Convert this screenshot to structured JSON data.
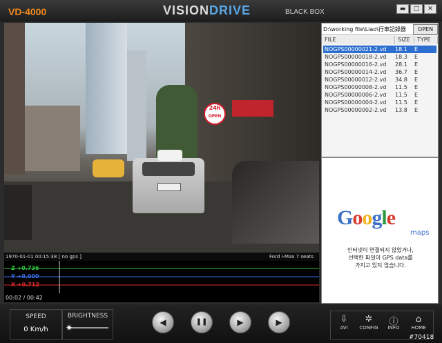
{
  "window": {
    "brand": "VD-4000",
    "title_main": "VISION",
    "title_accent": "DRIVE",
    "subtitle": "BLACK BOX",
    "minimize": "▬",
    "maximize": "□",
    "close": "✕"
  },
  "video": {
    "timestamp": "1970-01-01 00:15:38 [ no gps ]",
    "vehicle": "Ford i-Max 7 seats",
    "sign_text": "24h",
    "sign_sub": "OPEN"
  },
  "graph": {
    "z_label": "Z +0.736",
    "y_label": "Y +0.000",
    "x_label": "X +0.712",
    "colors": {
      "z": "#2ec23a",
      "y": "#3a6ee8",
      "x": "#e02b2b"
    },
    "time": "00:02 / 00:42"
  },
  "files": {
    "path": "D:\\working file\\Liao\\行車記錄器",
    "open_label": "OPEN",
    "columns": [
      "FILE",
      "SIZE",
      "TYPE"
    ],
    "rows": [
      {
        "file": "NOGPS00000021-2.vd",
        "size": "18.1",
        "type": "E",
        "selected": true
      },
      {
        "file": "NOGPS00000018-2.vd",
        "size": "18.3",
        "type": "E"
      },
      {
        "file": "NOGPS00000016-2.vd",
        "size": "28.1",
        "type": "E"
      },
      {
        "file": "NOGPS00000014-2.vd",
        "size": "36.7",
        "type": "E"
      },
      {
        "file": "NOGPS00000012-2.vd",
        "size": "34.8",
        "type": "E"
      },
      {
        "file": "NOGPS00000008-2.vd",
        "size": "11.5",
        "type": "E"
      },
      {
        "file": "NOGPS00000006-2.vd",
        "size": "11.5",
        "type": "E"
      },
      {
        "file": "NOGPS00000004-2.vd",
        "size": "11.5",
        "type": "E"
      },
      {
        "file": "NOGPS00000002-2.vd",
        "size": "13.8",
        "type": "E"
      }
    ]
  },
  "map": {
    "logo_letters": [
      "G",
      "o",
      "o",
      "g",
      "l",
      "e"
    ],
    "logo_colors": [
      "#3b70c8",
      "#d63b2e",
      "#f2b21b",
      "#3b70c8",
      "#2e9a40",
      "#d63b2e"
    ],
    "maps_label": "maps",
    "message_line1": "인터넷이 연결되지 않았거나,",
    "message_line2": "선택한 파일이 GPS data를",
    "message_line3": "가지고 있지 않습니다."
  },
  "controls": {
    "speed_label": "SPEED",
    "speed_value": "0 Km/h",
    "brightness_label": "BRIGHTNESS",
    "prev": "◀",
    "pause": "❚❚",
    "play": "▶",
    "next": "▶",
    "tools": [
      {
        "label": "AVI",
        "icon": "⇩"
      },
      {
        "label": "CONFIG",
        "icon": "✲"
      },
      {
        "label": "INFO",
        "icon": "ⓘ"
      },
      {
        "label": "HOME",
        "icon": "⌂"
      }
    ]
  },
  "watermark": "#70418"
}
